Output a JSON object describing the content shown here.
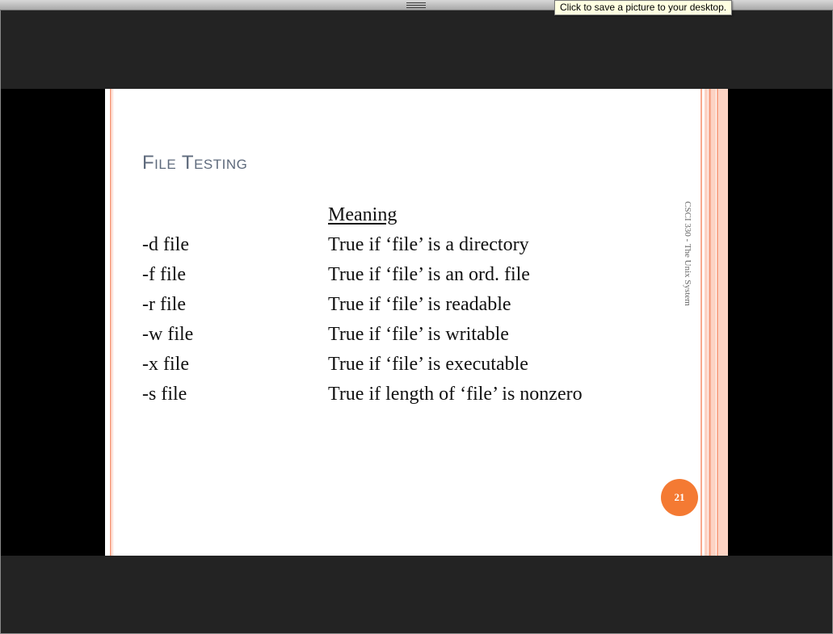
{
  "tooltip": {
    "text": "Click to save a picture to your desktop."
  },
  "slide": {
    "title": "File Testing",
    "table": {
      "header": {
        "operator": "",
        "meaning": "Meaning"
      },
      "rows": [
        {
          "operator": "-d file",
          "meaning": "True if ‘file’ is a directory"
        },
        {
          "operator": "-f file",
          "meaning": "True if ‘file’ is an ord. file"
        },
        {
          "operator": "-r file",
          "meaning": "True if ‘file’ is readable"
        },
        {
          "operator": "-w file",
          "meaning": "True if ‘file’ is writable"
        },
        {
          "operator": "-x file",
          "meaning": "True if ‘file’ is executable"
        },
        {
          "operator": "-s file",
          "meaning": "True if length of ‘file’ is nonzero"
        }
      ]
    },
    "side_label": "CSCI 330 - The Unix System",
    "page_number": "21"
  },
  "colors": {
    "accent_orange": "#f47a33",
    "title_gray": "#5e6a7c",
    "stripe_light": "#fcd3c4",
    "stripe_salmon": "#f8a98e"
  }
}
